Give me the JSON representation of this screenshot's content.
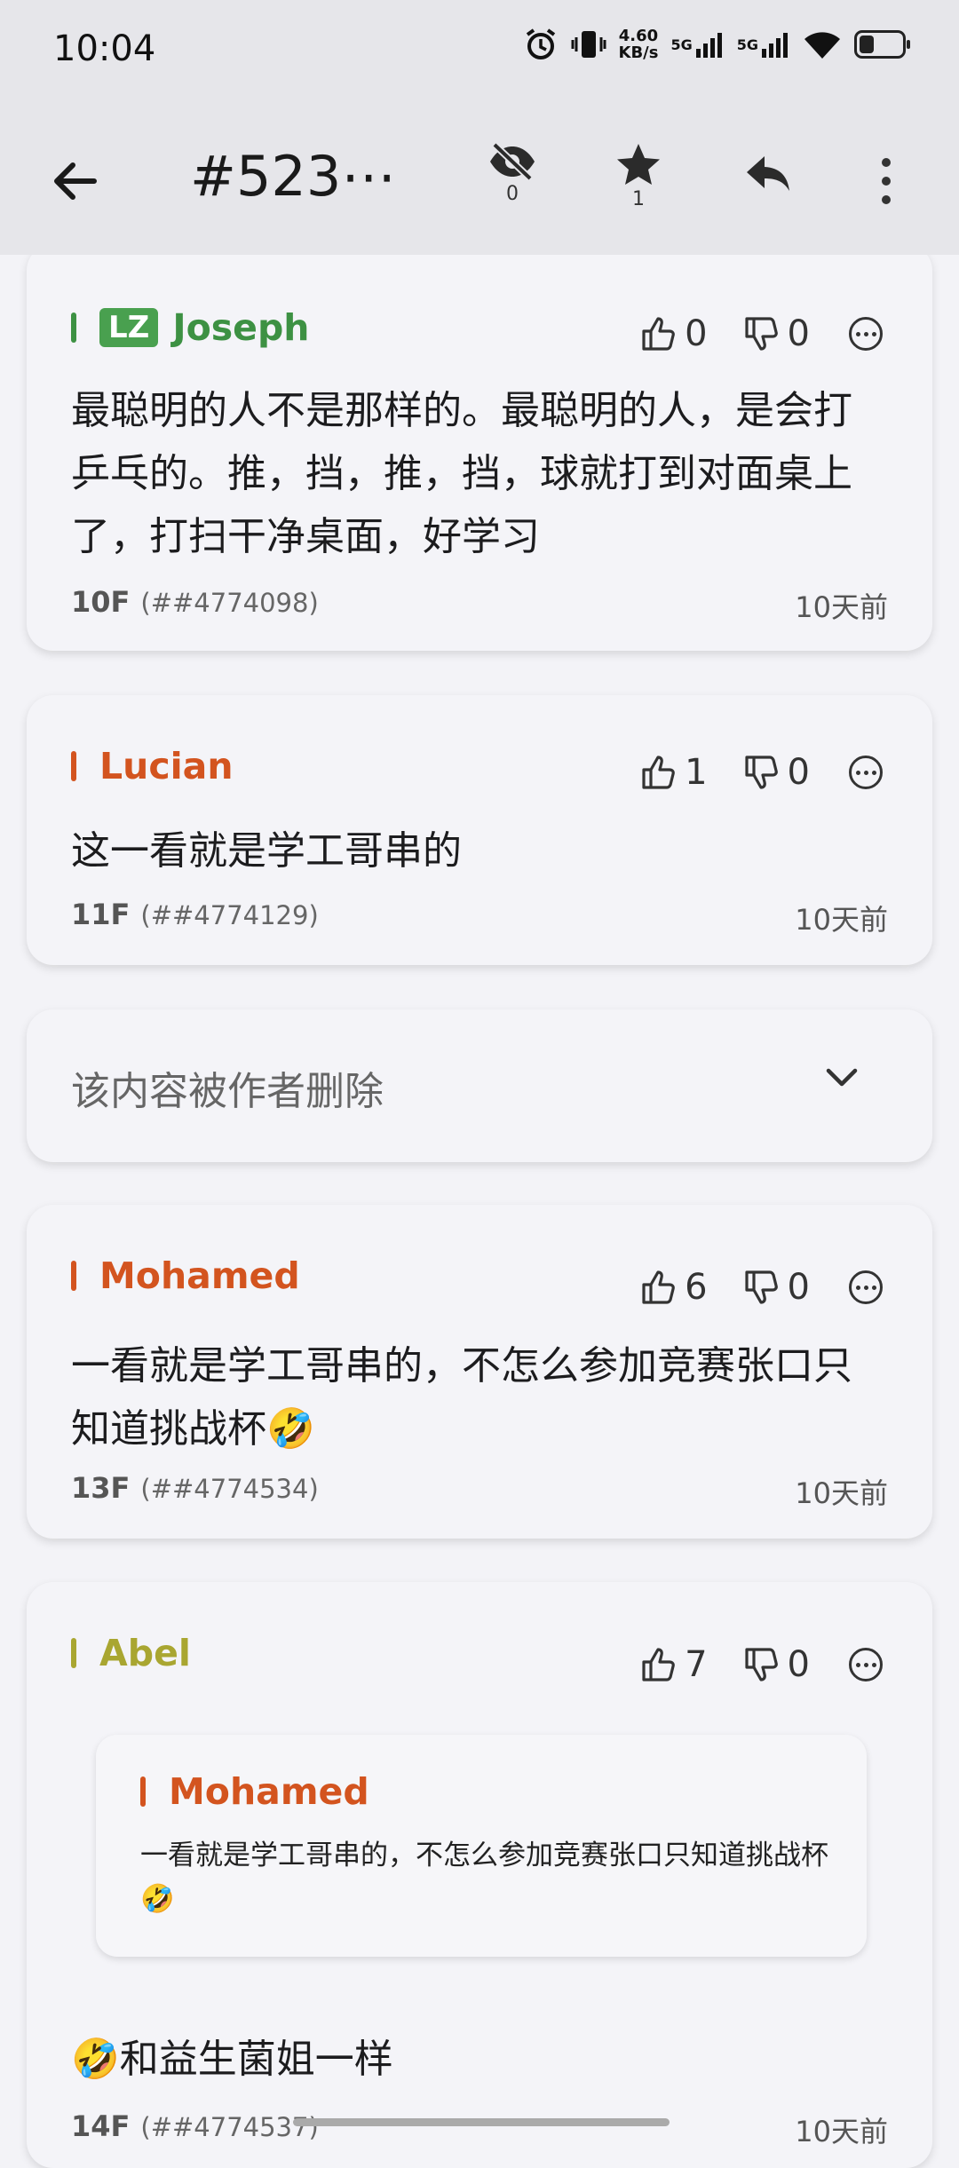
{
  "status_bar": {
    "time": "10:04",
    "net_speed_value": "4.60",
    "net_speed_unit": "KB/s",
    "sim1": "5G",
    "sim2": "5G",
    "battery_level": 0.35,
    "icons": [
      "alarm-icon",
      "vibrate-icon",
      "signal-icon",
      "wifi-icon",
      "battery-icon"
    ]
  },
  "header": {
    "title": "#523⋯",
    "hidden_count": "0",
    "star_count": "1"
  },
  "colors": {
    "op": "#3d9143",
    "lz_badge": "#49a04f",
    "red_author": "#d3541f",
    "olive_author": "#a9a631"
  },
  "posts": [
    {
      "is_op": true,
      "lz_badge": "LZ",
      "author": "Joseph",
      "likes": "0",
      "dislikes": "0",
      "text": "最聪明的人不是那样的。最聪明的人，是会打乒乓的。推，挡，推，挡，球就打到对面桌上了，打扫干净桌面，好学习",
      "floor": "10F",
      "post_id": "(##4774098)",
      "time": "10天前"
    },
    {
      "author": "Lucian",
      "likes": "1",
      "dislikes": "0",
      "text": "这一看就是学工哥串的",
      "floor": "11F",
      "post_id": "(##4774129)",
      "time": "10天前"
    },
    {
      "deleted": true,
      "text": "该内容被作者删除"
    },
    {
      "author": "Mohamed",
      "likes": "6",
      "dislikes": "0",
      "text": "一看就是学工哥串的，不怎么参加竞赛张口只知道挑战杯🤣",
      "floor": "13F",
      "post_id": "(##4774534)",
      "time": "10天前"
    },
    {
      "author": "Abel",
      "likes": "7",
      "dislikes": "0",
      "quote": {
        "author": "Mohamed",
        "text": "一看就是学工哥串的，不怎么参加竞赛张口只知道挑战杯🤣"
      },
      "text": "🤣和益生菌姐一样",
      "floor": "14F",
      "post_id": "(##4774537)",
      "time": "10天前"
    }
  ]
}
